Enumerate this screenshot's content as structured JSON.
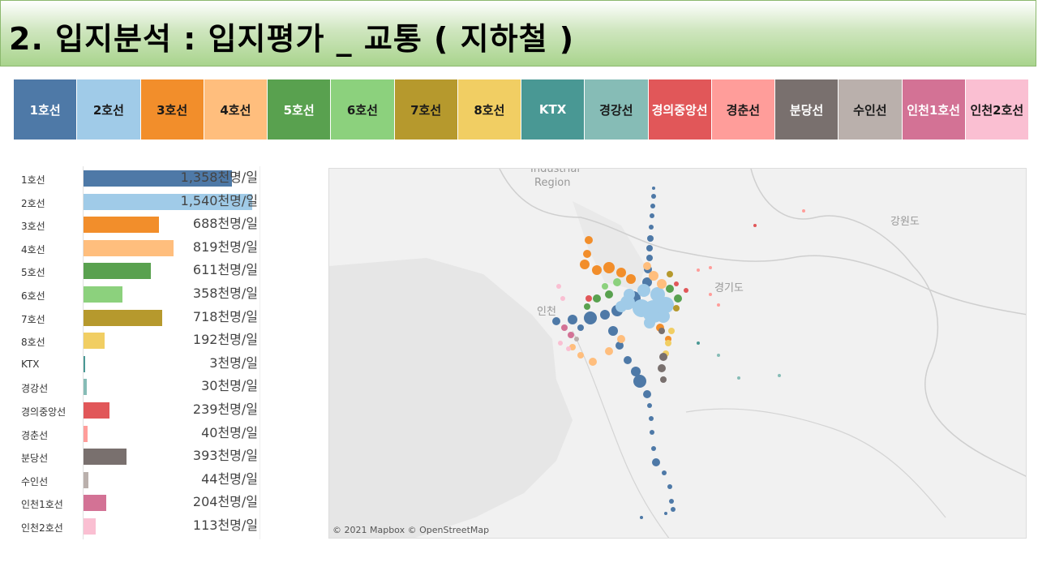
{
  "page": {
    "title": "2. 입지분석 : 입지평가 _ 교통 ( 지하철 )"
  },
  "legend": [
    {
      "label": "1호선",
      "color": "#4e79a7",
      "text_color": "#ffffff"
    },
    {
      "label": "2호선",
      "color": "#a0cbe8",
      "text_color": "#1a1a1a"
    },
    {
      "label": "3호선",
      "color": "#f28e2b",
      "text_color": "#1a1a1a"
    },
    {
      "label": "4호선",
      "color": "#ffbe7d",
      "text_color": "#1a1a1a"
    },
    {
      "label": "5호선",
      "color": "#59a14f",
      "text_color": "#ffffff"
    },
    {
      "label": "6호선",
      "color": "#8cd17d",
      "text_color": "#1a1a1a"
    },
    {
      "label": "7호선",
      "color": "#b6992d",
      "text_color": "#1a1a1a"
    },
    {
      "label": "8호선",
      "color": "#f1ce63",
      "text_color": "#1a1a1a"
    },
    {
      "label": "KTX",
      "color": "#499894",
      "text_color": "#ffffff"
    },
    {
      "label": "경강선",
      "color": "#86bcb6",
      "text_color": "#1a1a1a"
    },
    {
      "label": "경의중앙선",
      "color": "#e15759",
      "text_color": "#ffffff"
    },
    {
      "label": "경춘선",
      "color": "#ff9d9a",
      "text_color": "#1a1a1a"
    },
    {
      "label": "분당선",
      "color": "#79706e",
      "text_color": "#ffffff"
    },
    {
      "label": "수인선",
      "color": "#bab0ac",
      "text_color": "#1a1a1a"
    },
    {
      "label": "인천1호선",
      "color": "#d37295",
      "text_color": "#ffffff"
    },
    {
      "label": "인천2호선",
      "color": "#fabfd2",
      "text_color": "#1a1a1a"
    }
  ],
  "chart_data": {
    "type": "bar",
    "orientation": "horizontal",
    "categories": [
      "1호선",
      "2호선",
      "3호선",
      "4호선",
      "5호선",
      "6호선",
      "7호선",
      "8호선",
      "KTX",
      "경강선",
      "경의중앙선",
      "경춘선",
      "분당선",
      "수인선",
      "인천1호선",
      "인천2호선"
    ],
    "values": [
      1358,
      1540,
      688,
      819,
      611,
      358,
      718,
      192,
      3,
      30,
      239,
      40,
      393,
      44,
      204,
      113
    ],
    "value_labels": [
      "1,358천명/일",
      "1,540천명/일",
      "688천명/일",
      "819천명/일",
      "611천명/일",
      "358천명/일",
      "718천명/일",
      "192천명/일",
      "3천명/일",
      "30천명/일",
      "239천명/일",
      "40천명/일",
      "393천명/일",
      "44천명/일",
      "204천명/일",
      "113천명/일"
    ],
    "colors": [
      "#4e79a7",
      "#a0cbe8",
      "#f28e2b",
      "#ffbe7d",
      "#59a14f",
      "#8cd17d",
      "#b6992d",
      "#f1ce63",
      "#499894",
      "#86bcb6",
      "#e15759",
      "#ff9d9a",
      "#79706e",
      "#bab0ac",
      "#d37295",
      "#fabfd2"
    ],
    "xlim": [
      0,
      1540
    ],
    "grid": false,
    "title": "",
    "xlabel": "",
    "ylabel": ""
  },
  "map": {
    "labels": [
      "Region",
      "강원도",
      "경기도",
      "인천"
    ],
    "credit": "© 2021 Mapbox © OpenStreetMap"
  }
}
